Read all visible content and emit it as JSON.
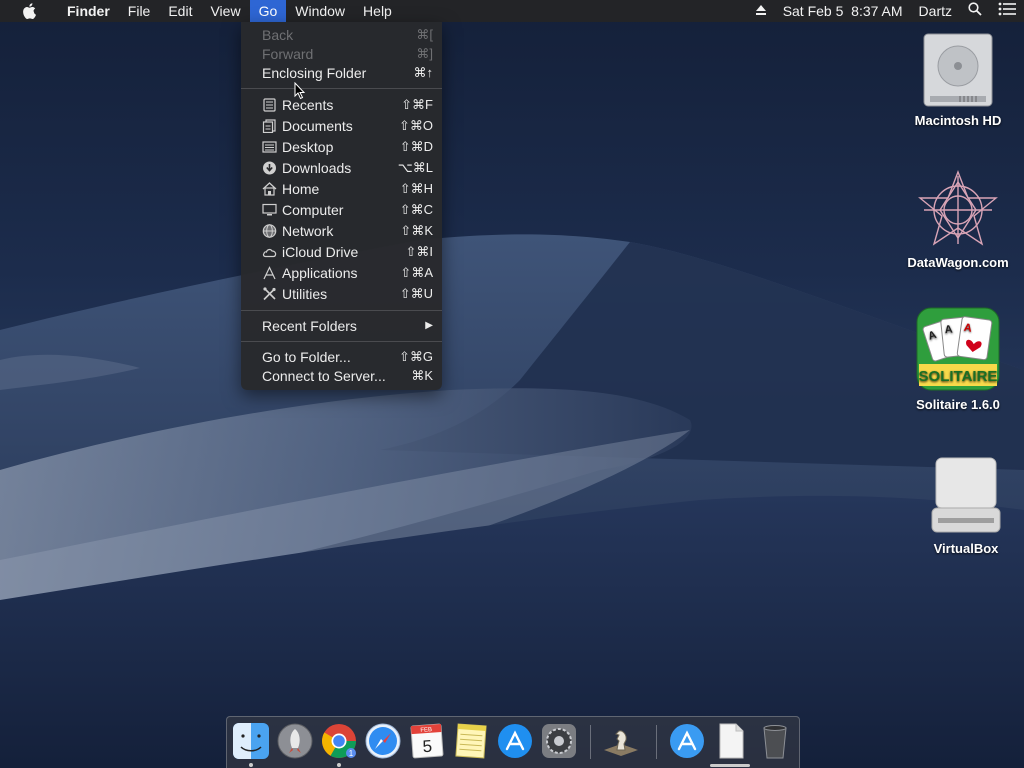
{
  "menubar": {
    "app_name": "Finder",
    "menus": [
      "File",
      "Edit",
      "View",
      "Go",
      "Window",
      "Help"
    ],
    "date_time": "Sat Feb 5  8:37 AM",
    "user": "Dartz"
  },
  "go_menu": {
    "items": [
      {
        "label": "Back",
        "shortcut": "⌘[",
        "enabled": false
      },
      {
        "label": "Forward",
        "shortcut": "⌘]",
        "enabled": false
      },
      {
        "label": "Enclosing Folder",
        "shortcut": "⌘↑",
        "enabled": true
      },
      {
        "label": "Recents",
        "shortcut": "⇧⌘F",
        "icon": "recents-icon"
      },
      {
        "label": "Documents",
        "shortcut": "⇧⌘O",
        "icon": "documents-icon"
      },
      {
        "label": "Desktop",
        "shortcut": "⇧⌘D",
        "icon": "desktop-icon"
      },
      {
        "label": "Downloads",
        "shortcut": "⌥⌘L",
        "icon": "downloads-icon"
      },
      {
        "label": "Home",
        "shortcut": "⇧⌘H",
        "icon": "home-icon"
      },
      {
        "label": "Computer",
        "shortcut": "⇧⌘C",
        "icon": "computer-icon"
      },
      {
        "label": "Network",
        "shortcut": "⇧⌘K",
        "icon": "network-icon"
      },
      {
        "label": "iCloud Drive",
        "shortcut": "⇧⌘I",
        "icon": "icloud-icon"
      },
      {
        "label": "Applications",
        "shortcut": "⇧⌘A",
        "icon": "applications-icon"
      },
      {
        "label": "Utilities",
        "shortcut": "⇧⌘U",
        "icon": "utilities-icon"
      },
      {
        "label": "Recent Folders",
        "submenu": "▶"
      },
      {
        "label": "Go to Folder...",
        "shortcut": "⇧⌘G"
      },
      {
        "label": "Connect to Server...",
        "shortcut": "⌘K"
      }
    ]
  },
  "desktop_icons": [
    {
      "label": "Macintosh HD",
      "icon": "hard-drive-icon"
    },
    {
      "label": "DataWagon.com",
      "icon": "datawagon-icon"
    },
    {
      "label": "Solitaire 1.6.0",
      "icon": "solitaire-icon",
      "badge": "SOLITAIRE"
    },
    {
      "label": "VirtualBox",
      "icon": "virtualbox-disk-icon"
    }
  ],
  "dock": {
    "apps": [
      "finder-icon",
      "launchpad-icon",
      "chrome-icon",
      "safari-icon",
      "calendar-icon",
      "notes-icon",
      "app-store-icon",
      "system-preferences-icon",
      "chess-icon",
      "app-store-folder-icon",
      "document-icon",
      "trash-icon"
    ],
    "calendar_month": "FEB",
    "calendar_day": "5",
    "chrome_badge": "1"
  },
  "colors": {
    "menu_highlight": "#2e66d4",
    "menubar_bg": "#232427",
    "menu_bg": "#28292c"
  }
}
